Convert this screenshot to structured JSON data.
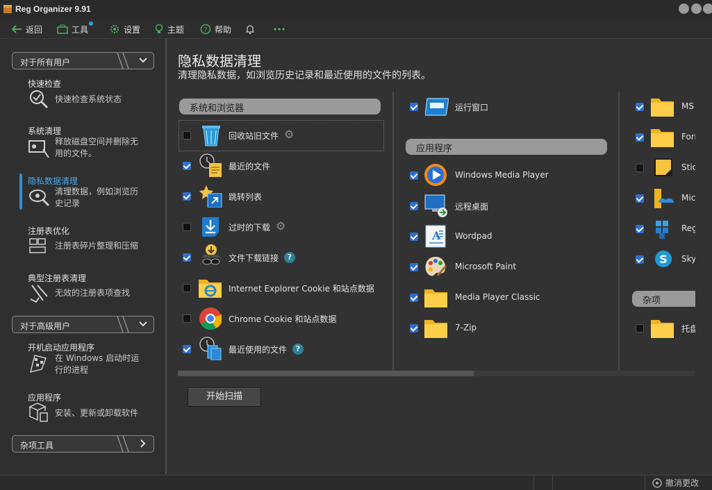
{
  "app": {
    "title": "Reg Organizer 9.91"
  },
  "toolbar": {
    "back": "返回",
    "tools": "工具",
    "settings": "设置",
    "themes": "主题",
    "help": "帮助"
  },
  "sidebar": {
    "group_all_users": "对于所有用户",
    "group_advanced": "对于高级用户",
    "group_misc": "杂项工具",
    "items": [
      {
        "title": "快速检查",
        "desc": "快速检查系统状态"
      },
      {
        "title": "系统清理",
        "desc": "释放磁盘空间并删除无用的文件。"
      },
      {
        "title": "隐私数据清理",
        "desc": "清理数据，例如浏览历史记录"
      },
      {
        "title": "注册表优化",
        "desc": "注册表碎片整理和压缩"
      },
      {
        "title": "典型注册表清理",
        "desc": "无效的注册表项查找"
      },
      {
        "title": "开机启动应用程序",
        "desc": "在 Windows 启动时运行的进程"
      },
      {
        "title": "应用程序",
        "desc": "安装、更新或卸载软件"
      }
    ]
  },
  "main": {
    "title": "隐私数据清理",
    "subtitle": "清理隐私数据，如浏览历史记录和最近使用的文件的列表。",
    "sections": {
      "system_browsers": "系统和浏览器",
      "apps": "应用程序",
      "misc": "杂项"
    },
    "col1": [
      {
        "label": "回收站旧文件",
        "checked": false
      },
      {
        "label": "最近的文件",
        "checked": true
      },
      {
        "label": "跳转列表",
        "checked": true
      },
      {
        "label": "过时的下载",
        "checked": false
      },
      {
        "label": "文件下载链接",
        "checked": true
      },
      {
        "label": "Internet Explorer Cookie 和站点数据",
        "checked": false
      },
      {
        "label": "Chrome Cookie 和站点数据",
        "checked": false
      },
      {
        "label": "最近使用的文件",
        "checked": true
      }
    ],
    "col2_top": {
      "label": "运行窗口",
      "checked": true
    },
    "col2": [
      {
        "label": "Windows Media Player",
        "checked": true
      },
      {
        "label": "远程桌面",
        "checked": true
      },
      {
        "label": "Wordpad",
        "checked": true
      },
      {
        "label": "Microsoft Paint",
        "checked": true
      },
      {
        "label": "Media Player Classic",
        "checked": true
      },
      {
        "label": "7-Zip",
        "checked": true
      }
    ],
    "col3": [
      {
        "label": "MS",
        "checked": true
      },
      {
        "label": "Forr",
        "checked": true
      },
      {
        "label": "Stick",
        "checked": false
      },
      {
        "label": "Mic",
        "checked": true
      },
      {
        "label": "Reg",
        "checked": true
      },
      {
        "label": "Skyp",
        "checked": true
      }
    ],
    "col3_misc": {
      "label": "托盘",
      "checked": false
    },
    "scan_button": "开始扫描"
  },
  "status": {
    "undo": "撤消更改"
  }
}
